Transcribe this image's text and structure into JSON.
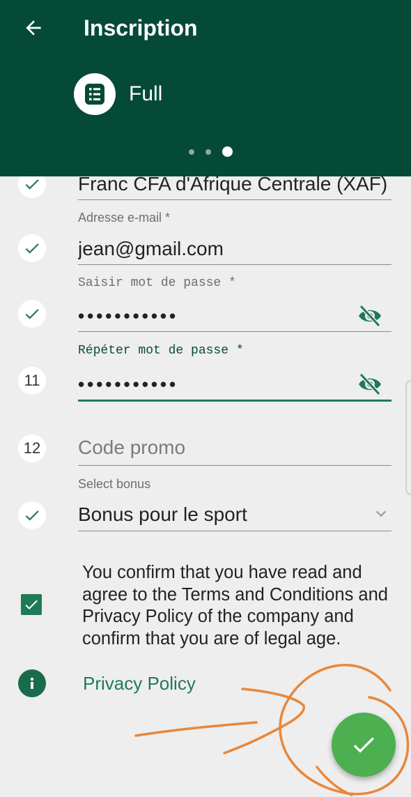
{
  "header": {
    "title": "Inscription",
    "back_icon": "arrow-left-icon",
    "mode_icon": "list-form-icon",
    "mode_label": "Full",
    "pager": {
      "total": 3,
      "active": 3
    }
  },
  "form": {
    "currency": {
      "step_icon": "check-icon",
      "value": "Franc CFA d'Afrique Centrale (XAF)"
    },
    "email": {
      "step_icon": "check-icon",
      "label": "Adresse e-mail *",
      "value": "jean@gmail.com"
    },
    "password": {
      "step_icon": "check-icon",
      "label": "Saisir mot de passe *",
      "value": "•••••••••••",
      "toggle_icon": "eye-off-icon"
    },
    "repeat_password": {
      "step": "11",
      "label": "Répéter mot de passe *",
      "value": "•••••••••••",
      "toggle_icon": "eye-off-icon"
    },
    "promo": {
      "step": "12",
      "placeholder": "Code promo"
    },
    "bonus": {
      "step_icon": "check-icon",
      "label": "Select bonus",
      "value": "Bonus pour le sport",
      "dropdown_icon": "chevron-down-icon"
    }
  },
  "terms": {
    "checked": true,
    "text": "You confirm that you have read and agree to the Terms and Conditions and Privacy Policy of the company and confirm that you are of legal age."
  },
  "privacy": {
    "icon": "info-icon",
    "label": "Privacy Policy"
  },
  "submit": {
    "icon": "check-icon"
  },
  "colors": {
    "header_bg": "#054a36",
    "accent": "#1f7a57",
    "fab": "#4caf50",
    "background": "#eeeeee",
    "annotation": "#e8873a"
  }
}
